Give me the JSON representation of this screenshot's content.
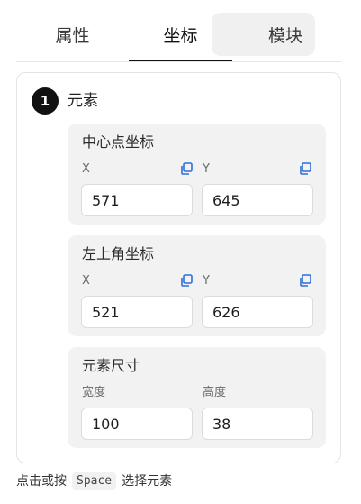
{
  "tabs": [
    {
      "label": "属性"
    },
    {
      "label": "坐标"
    },
    {
      "label": "模块"
    }
  ],
  "panel": {
    "step_number": "1",
    "step_title": "元素",
    "groups": {
      "center": {
        "title": "中心点坐标",
        "x_label": "X",
        "y_label": "Y",
        "x_value": "571",
        "y_value": "645"
      },
      "top_left": {
        "title": "左上角坐标",
        "x_label": "X",
        "y_label": "Y",
        "x_value": "521",
        "y_value": "626"
      },
      "size": {
        "title": "元素尺寸",
        "width_label": "宽度",
        "height_label": "高度",
        "width_value": "100",
        "height_value": "38"
      }
    }
  },
  "hint": {
    "prefix": "点击或按",
    "key": "Space",
    "suffix": "选择元素"
  },
  "colors": {
    "accent_icon": "#2f6fd6",
    "active_tab_underline": "#111111",
    "group_bg": "#f2f2f2"
  },
  "icons": {
    "copy": "copy-icon"
  }
}
